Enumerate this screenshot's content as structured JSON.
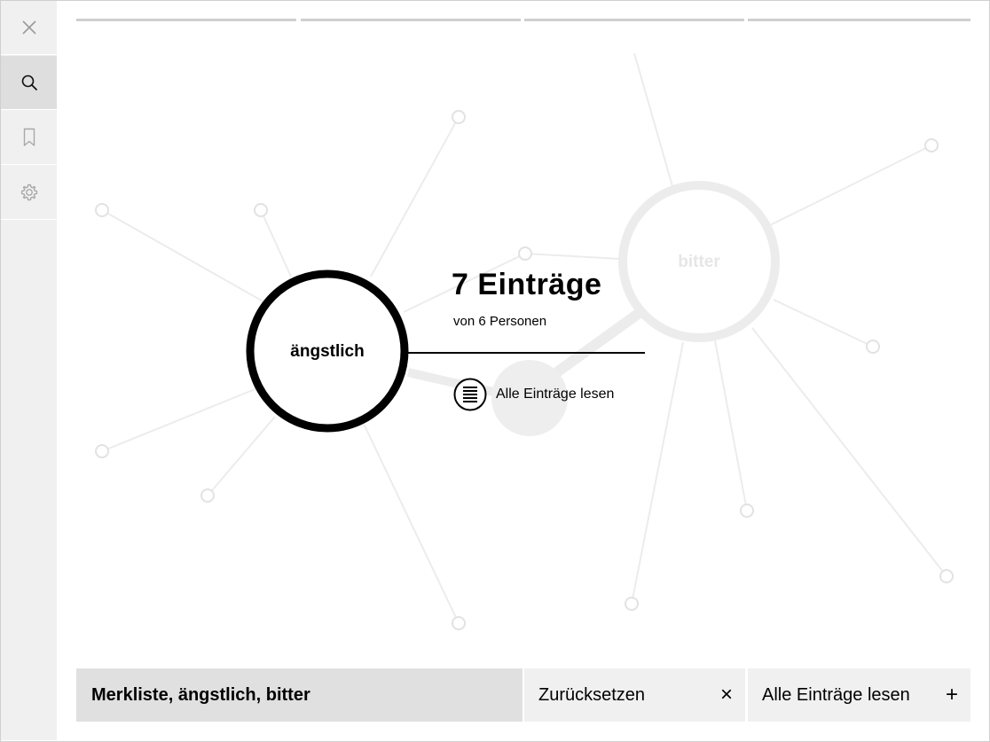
{
  "sidebar": {
    "items": [
      {
        "icon": "close-icon",
        "active": false
      },
      {
        "icon": "search-icon",
        "active": true
      },
      {
        "icon": "bookmark-icon",
        "active": false
      },
      {
        "icon": "gear-icon",
        "active": false
      }
    ]
  },
  "graph": {
    "primary_node": "ängstlich",
    "secondary_node": "bitter"
  },
  "info": {
    "count": "7 Einträge",
    "persons": "von 6 Personen",
    "read_all": "Alle Einträge lesen"
  },
  "bottom_bar": {
    "filter_label": "Merkliste, ängstlich, bitter",
    "reset_label": "Zurücksetzen",
    "reset_icon": "×",
    "read_all_label": "Alle Einträge lesen",
    "read_all_icon": "+"
  },
  "colors": {
    "accent": "#000000",
    "sidebar_bg": "#f0f0f0",
    "sidebar_active_bg": "#dedede",
    "faded": "#ececec",
    "filter_bg": "#e0e0e0"
  }
}
